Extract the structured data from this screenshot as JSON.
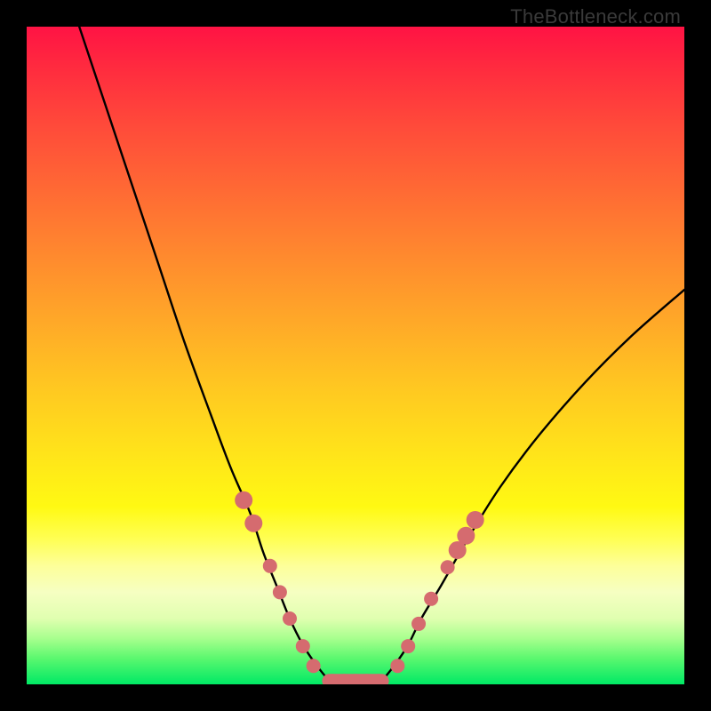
{
  "watermark": "TheBottleneck.com",
  "colors": {
    "frame_background": "#000000",
    "curve_stroke": "#000000",
    "marker_fill": "#d56b6f",
    "gradient_top": "#ff1344",
    "gradient_bottom": "#00e965",
    "watermark_text": "#3a3a3a"
  },
  "chart_data": {
    "type": "line",
    "title": "",
    "xlabel": "",
    "ylabel": "",
    "xlim": [
      0,
      100
    ],
    "ylim": [
      0,
      100
    ],
    "series": [
      {
        "name": "left-curve",
        "x": [
          8,
          12,
          16,
          20,
          24,
          28,
          31,
          34,
          36,
          38,
          40,
          42,
          44,
          46
        ],
        "y": [
          100,
          88,
          76,
          64,
          52,
          41,
          33,
          26,
          20,
          15,
          10,
          6,
          3,
          0.5
        ]
      },
      {
        "name": "right-curve",
        "x": [
          54,
          56,
          58,
          60,
          63,
          67,
          72,
          78,
          85,
          92,
          100
        ],
        "y": [
          0.5,
          3,
          6,
          10,
          15,
          22,
          30,
          38,
          46,
          53,
          60
        ]
      }
    ],
    "floor_segment": {
      "x_start": 46,
      "x_end": 54,
      "y": 0.5
    },
    "markers_left": [
      {
        "x": 33,
        "y": 28,
        "r": 1.4
      },
      {
        "x": 34.5,
        "y": 24.5,
        "r": 1.4
      },
      {
        "x": 37,
        "y": 18,
        "r": 1.2
      },
      {
        "x": 38.5,
        "y": 14,
        "r": 1.2
      },
      {
        "x": 40,
        "y": 10,
        "r": 1.2
      },
      {
        "x": 42,
        "y": 5.8,
        "r": 1.2
      },
      {
        "x": 43.6,
        "y": 2.8,
        "r": 1.2
      }
    ],
    "markers_right": [
      {
        "x": 56.4,
        "y": 2.8,
        "r": 1.2
      },
      {
        "x": 58,
        "y": 5.8,
        "r": 1.2
      },
      {
        "x": 59.6,
        "y": 9.2,
        "r": 1.2
      },
      {
        "x": 61.5,
        "y": 13,
        "r": 1.2
      },
      {
        "x": 64,
        "y": 17.8,
        "r": 1.2
      },
      {
        "x": 65.5,
        "y": 20.4,
        "r": 1.4
      },
      {
        "x": 66.8,
        "y": 22.6,
        "r": 1.4
      },
      {
        "x": 68.2,
        "y": 25,
        "r": 1.4
      }
    ],
    "markers_floor": [
      {
        "x": 46.5,
        "y": 0.5,
        "r": 1.2
      },
      {
        "x": 48.3,
        "y": 0.5,
        "r": 1.2
      },
      {
        "x": 50.0,
        "y": 0.5,
        "r": 1.2
      },
      {
        "x": 51.7,
        "y": 0.5,
        "r": 1.2
      },
      {
        "x": 53.5,
        "y": 0.5,
        "r": 1.2
      }
    ]
  }
}
